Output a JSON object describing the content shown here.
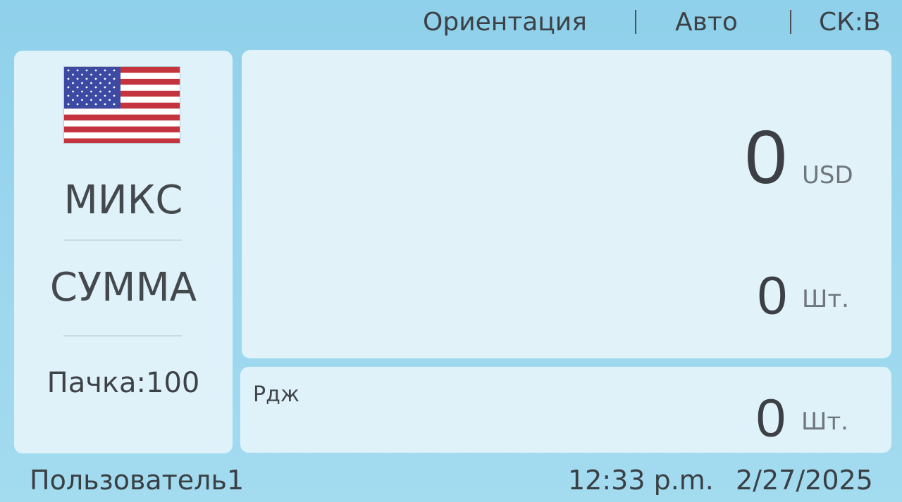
{
  "topbar": {
    "orientation_label": "Ориентация",
    "mode_label": "Авто",
    "speed_label": "СК:В"
  },
  "left_panel": {
    "currency_icon": "usa-flag-icon",
    "mode": "МИКС",
    "count_mode": "СУММА",
    "batch_label": "Пачка:100"
  },
  "counter": {
    "amount": "0",
    "currency": "USD",
    "pieces": "0",
    "pieces_unit": "Шт."
  },
  "reject": {
    "label": "Рдж",
    "count": "0",
    "unit": "Шт."
  },
  "status": {
    "user": "Пользователь1",
    "time": "12:33 p.m.",
    "date": "2/27/2025"
  },
  "colors": {
    "background": "#9ad6ee",
    "panel": "#e0f2f9",
    "text": "#3a3f44"
  }
}
